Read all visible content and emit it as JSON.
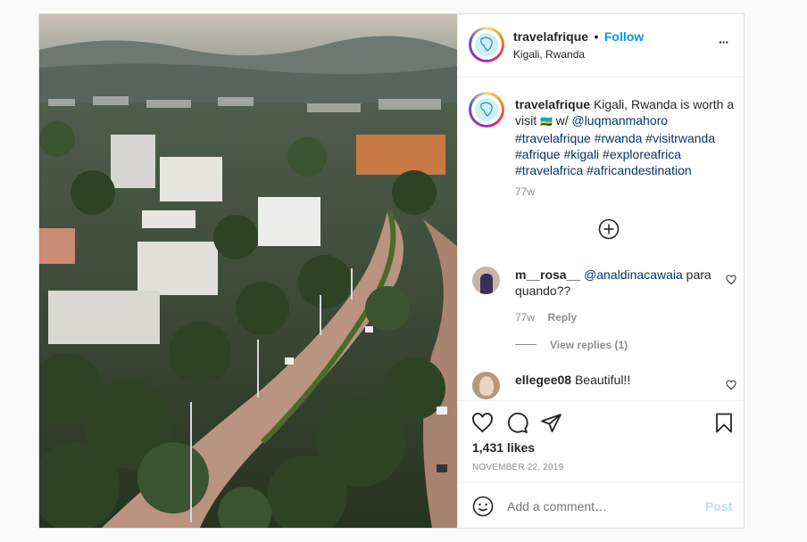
{
  "post": {
    "username": "travelafrique",
    "separator": "•",
    "follow_label": "Follow",
    "location": "Kigali, Rwanda",
    "more_label": "···"
  },
  "caption": {
    "username": "travelafrique",
    "text_part1": "Kigali, Rwanda is worth a visit ",
    "flag": "🇷🇼",
    "text_part2": " w/ ",
    "mention": "@luqmanmahoro",
    "hashtags_line1": "#travelafrique #rwanda #visitrwanda",
    "hashtags_line2": "#afrique #kigali #exploreafrica",
    "hashtags_line3": "#travelafrica #africandestination",
    "time": "77w"
  },
  "comments": [
    {
      "username": "m__rosa__",
      "mention": "@analdinacawaia",
      "text": " para quando??",
      "time": "77w",
      "reply_label": "Reply",
      "view_replies": "View replies (1)"
    },
    {
      "username": "ellegee08",
      "text": " Beautiful!!"
    }
  ],
  "likes": "1,431 likes",
  "date": "NOVEMBER 22, 2019",
  "add_comment_placeholder": "Add a comment…",
  "post_label": "Post",
  "icons": [
    "heart-icon",
    "comment-icon",
    "share-icon",
    "bookmark-icon",
    "emoji-icon",
    "plus-circle-icon",
    "more-icon"
  ]
}
